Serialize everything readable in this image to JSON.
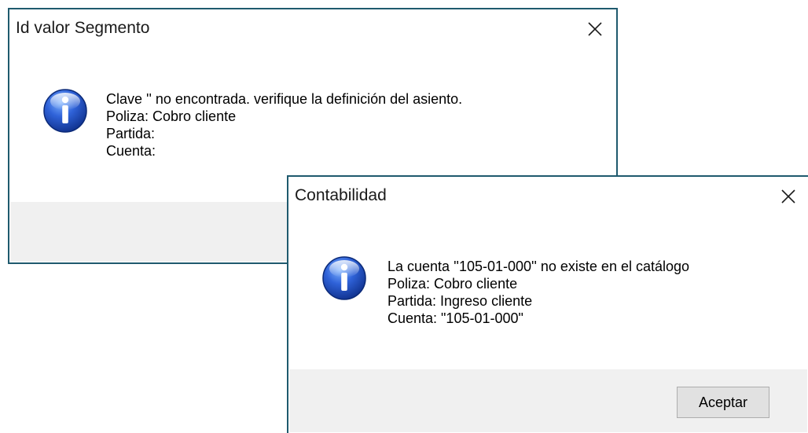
{
  "dialogs": [
    {
      "title": "Id valor Segmento",
      "icon": "info-icon",
      "lines": [
        "Clave '' no encontrada. verifique la definición del asiento.",
        "Poliza: Cobro cliente",
        "Partida:",
        "Cuenta:"
      ]
    },
    {
      "title": "Contabilidad",
      "icon": "info-icon",
      "lines": [
        "La cuenta ''105-01-000'' no existe en el catálogo",
        "Poliza: Cobro cliente",
        "Partida: Ingreso cliente",
        "Cuenta: \"105-01-000\""
      ],
      "button_label": "Aceptar"
    }
  ],
  "colors": {
    "border": "#1f5a6e",
    "footer": "#f0f0f0",
    "button": "#e1e1e1",
    "icon_blue": "#1f4fbf"
  }
}
